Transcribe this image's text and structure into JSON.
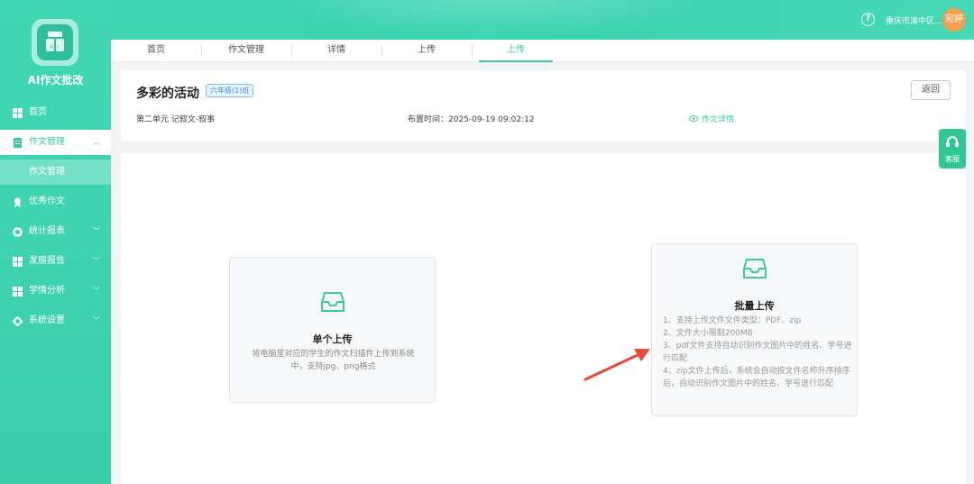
{
  "app": {
    "name": "AI作文批改"
  },
  "header": {
    "school": "重庆市渝中区...",
    "avatar_text": "宛婷",
    "help_icon": "question-circle-icon"
  },
  "sidebar": {
    "items": [
      {
        "label": "首页",
        "icon": "grid-icon"
      },
      {
        "label": "作文管理",
        "icon": "document-icon",
        "expanded": true
      },
      {
        "label": "作文管理",
        "sub": true
      },
      {
        "label": "优秀作文",
        "icon": "award-icon"
      },
      {
        "label": "统计报表",
        "icon": "ring-icon"
      },
      {
        "label": "发展报告",
        "icon": "grid-icon"
      },
      {
        "label": "学情分析",
        "icon": "grid-icon"
      },
      {
        "label": "系统设置",
        "icon": "gear-icon"
      }
    ]
  },
  "tabs": [
    {
      "label": "首页"
    },
    {
      "label": "作文管理"
    },
    {
      "label": "详情"
    },
    {
      "label": "上传"
    },
    {
      "label": "上传",
      "active": true
    }
  ],
  "info": {
    "title": "多彩的活动",
    "grade_badge": "六年级(1)班",
    "back_label": "返回",
    "unit": "第二单元 记叙文-叙事",
    "assign_label": "布置时间：",
    "assign_time": "2025-09-19 09:02:12",
    "detail_link": "作文详情"
  },
  "single_upload": {
    "title": "单个上传",
    "desc": "将电脑里对应的学生的作文扫描件上传到系统中，支持jpg、png格式"
  },
  "batch_upload": {
    "title": "批量上传",
    "lines": [
      "1、支持上传文件文件类型：PDF、zip",
      "2、文件大小限制200MB",
      "3、pdf文件支持自动识别作文图片中的姓名、学号进行匹配",
      "4、zip文件上传后，系统会自动按文件名称升序排序后，自动识别作文图片中的姓名、学号进行匹配"
    ]
  },
  "service": {
    "label": "客服"
  },
  "colors": {
    "accent": "#3cc9a7",
    "sidebar": "#3fd4b0",
    "arrow": "#e84a3a"
  }
}
